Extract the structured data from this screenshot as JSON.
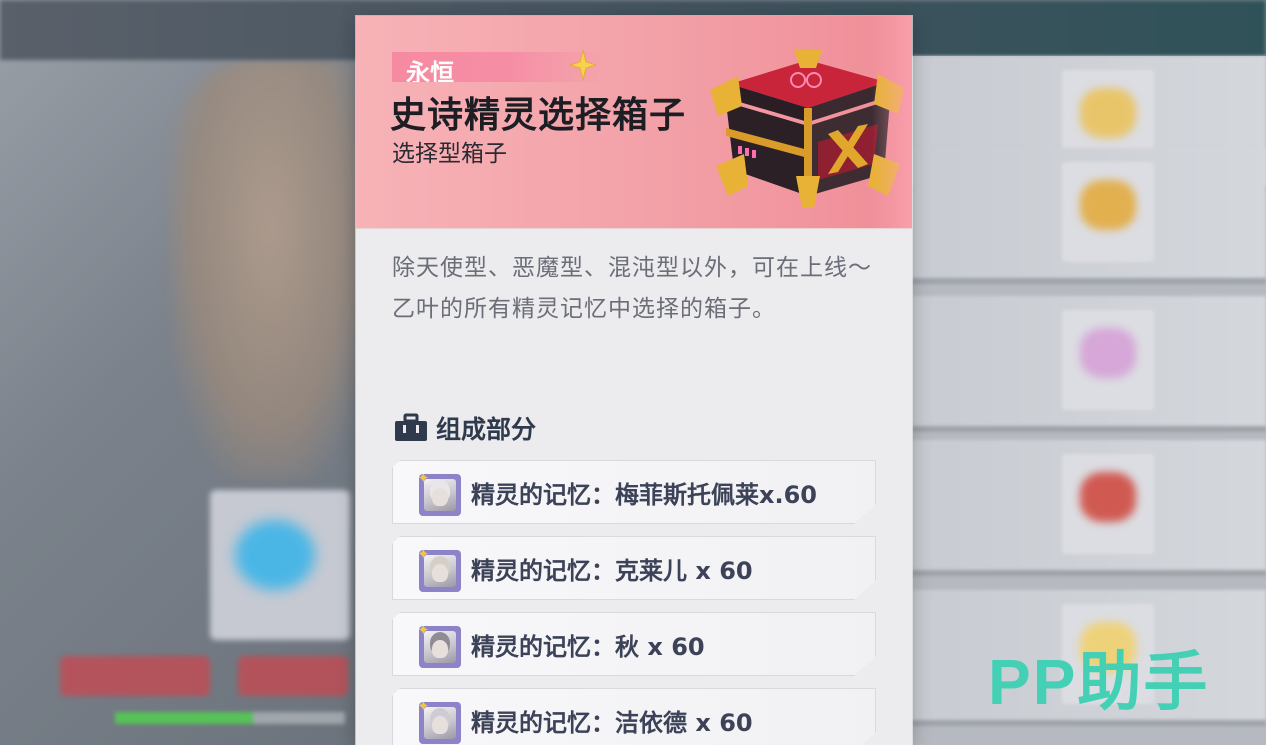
{
  "item": {
    "rarity": "永恒",
    "name": "史诗精灵选择箱子",
    "type": "选择型箱子",
    "description": "除天使型、恶魔型、混沌型以外，可在上线～乙叶的所有精灵记忆中选择的箱子。"
  },
  "components": {
    "title": "组成部分",
    "items": [
      {
        "label": "精灵的记忆：梅菲斯托佩莱x.60",
        "icon": "spirit-portrait-icon"
      },
      {
        "label": "精灵的记忆：克莱儿 x 60",
        "icon": "spirit-portrait-icon"
      },
      {
        "label": "精灵的记忆：秋 x 60",
        "icon": "spirit-portrait-icon"
      },
      {
        "label": "精灵的记忆：洁依德 x 60",
        "icon": "spirit-portrait-icon"
      }
    ]
  },
  "watermark": "PP助手",
  "colors": {
    "header_pink": "#f3a2a9",
    "rarity_tag": "#f68aa0",
    "text_dark": "#1d1d24",
    "text_desc": "#6b6e78",
    "watermark": "#44d0b4"
  }
}
